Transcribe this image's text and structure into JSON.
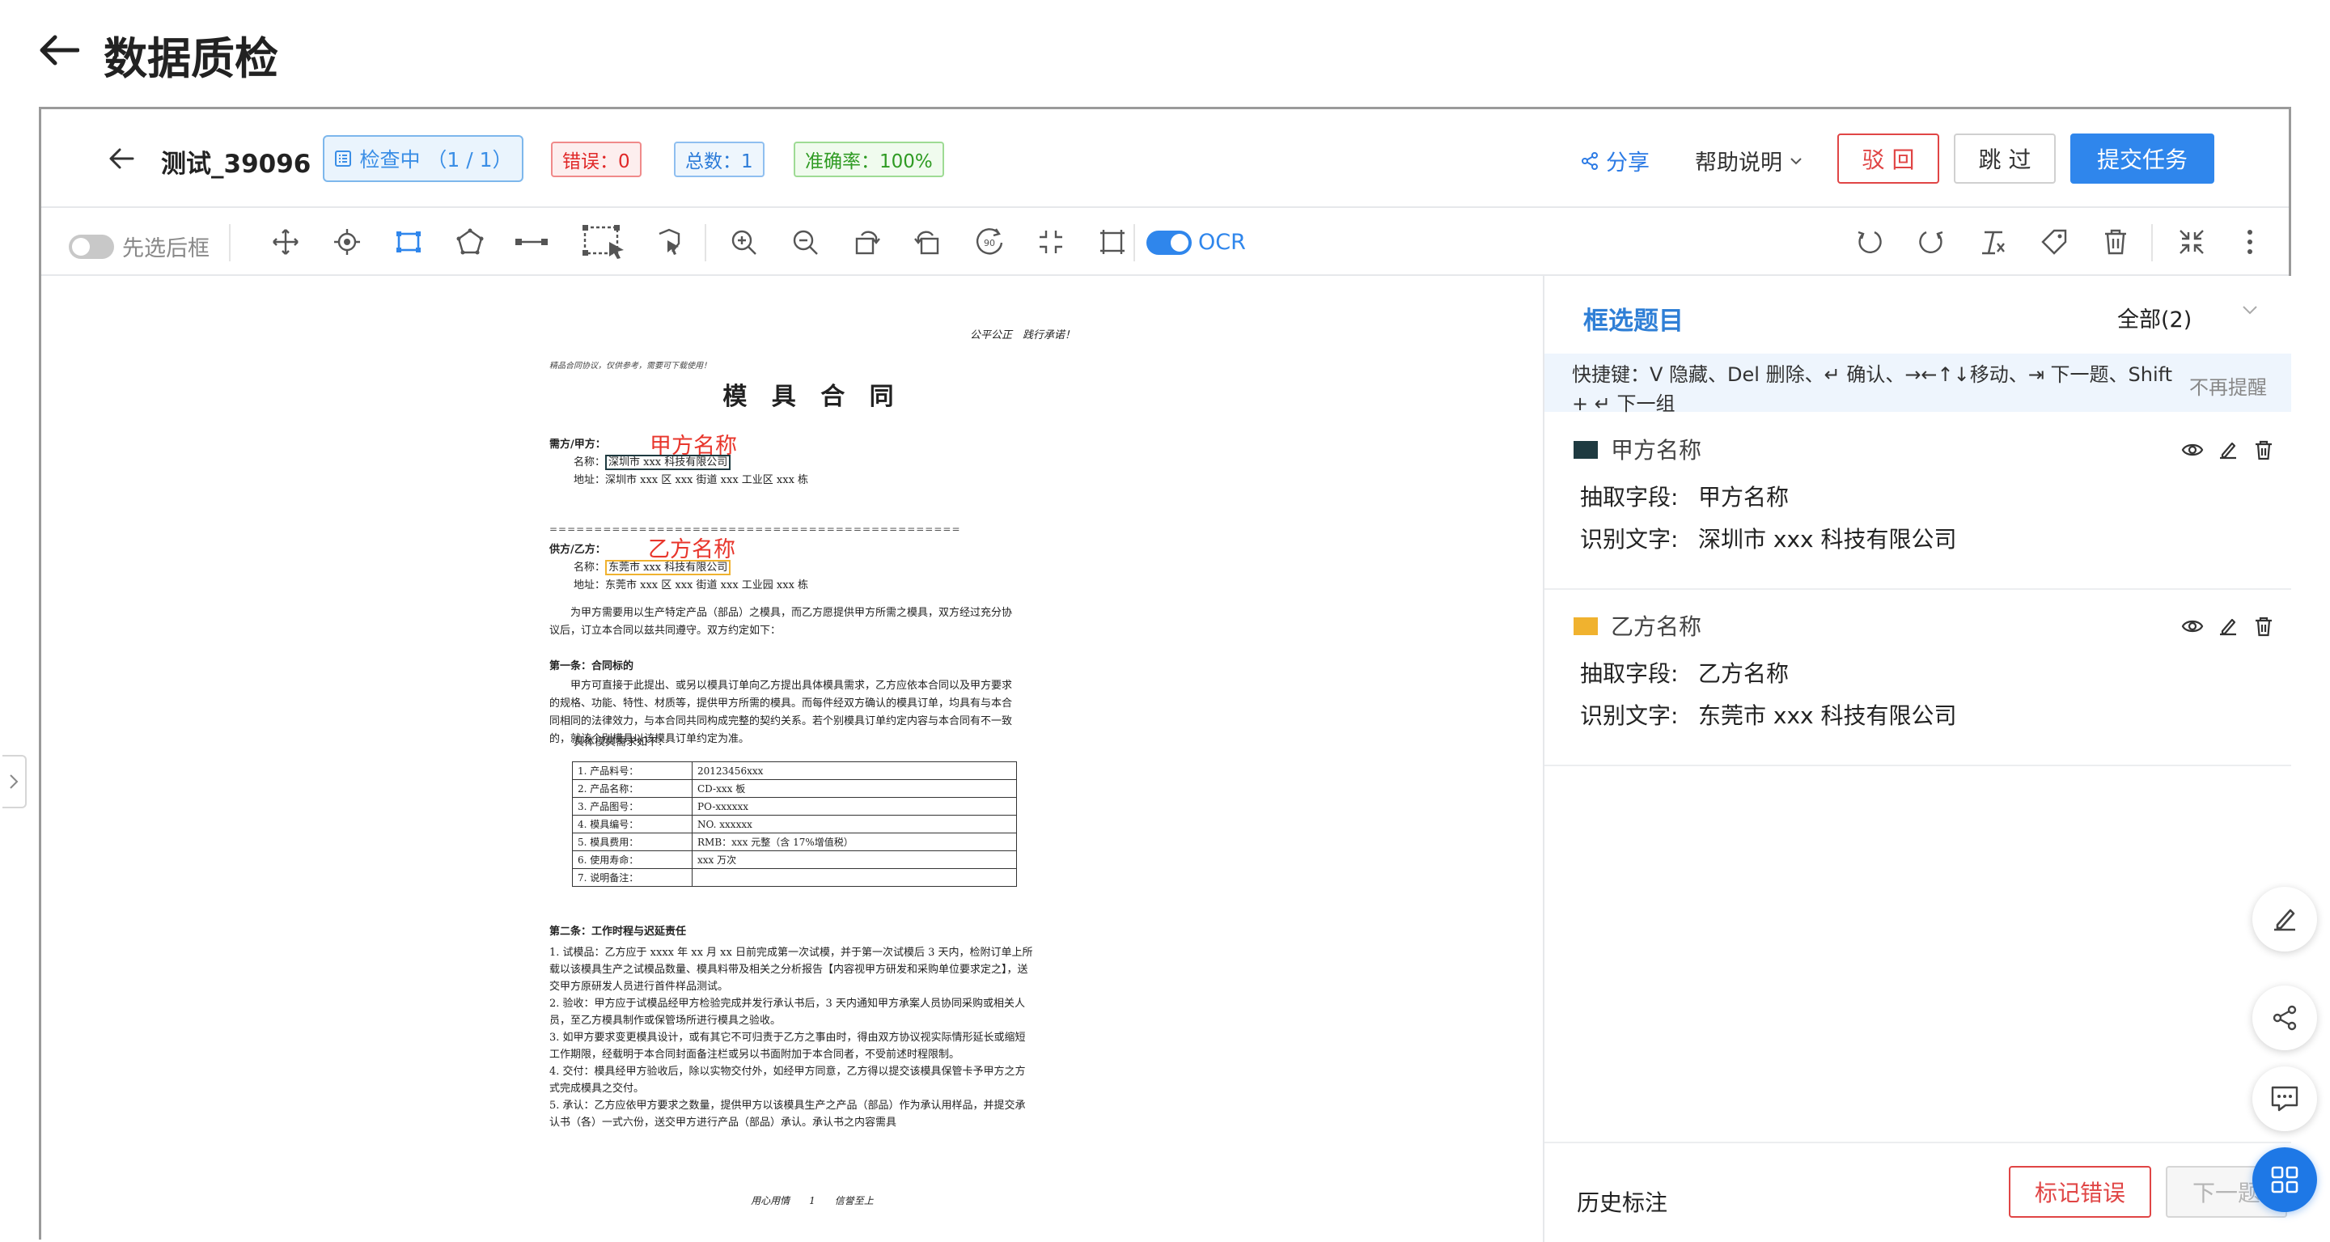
{
  "page": {
    "title": "数据质检"
  },
  "taskbar": {
    "task_name": "测试_39096",
    "status": "检查中 （1 / 1）",
    "error_tag": "错误：0",
    "total_tag": "总数：1",
    "accuracy_tag": "准确率：100%",
    "share": "分享",
    "help": "帮助说明",
    "reject": "驳 回",
    "skip": "跳 过",
    "submit": "提交任务"
  },
  "toolbar": {
    "box_first_label": "先选后框",
    "box_first_on": false,
    "ocr_label": "OCR",
    "ocr_on": true,
    "tools": [
      "move-icon",
      "point-icon",
      "rect-icon",
      "polygon-icon",
      "line-icon",
      "smart-select-icon",
      "cursor-select-icon",
      "zoom-in-icon",
      "zoom-out-icon",
      "rotate-left-icon",
      "rotate-right-icon",
      "rotate-90-icon",
      "fit-icon",
      "crop-icon"
    ],
    "right_tools": [
      "undo-icon",
      "redo-icon",
      "clear-icon",
      "tag-icon",
      "delete-icon",
      "fullscreen-icon",
      "more-icon"
    ]
  },
  "document": {
    "motto": "公平公正　践行承诺！",
    "note": "精品合同协议，仅供参考，需要可下载使用！",
    "title": "模 具 合 同",
    "party_a_heading": "需方/甲方：",
    "party_a_name_label": "名称：",
    "party_a_name": "深圳市 xxx 科技有限公司",
    "party_a_addr": "地址：深圳市 xxx 区 xxx 街道 xxx 工业区 xxx 栋",
    "party_b_heading": "供方/乙方：",
    "party_b_name_label": "名称：",
    "party_b_name": "东莞市 xxx 科技有限公司",
    "party_b_addr": "地址：东莞市 xxx 区 xxx 街道 xxx 工业园 xxx 栋",
    "ann_a": "甲方名称",
    "ann_b": "乙方名称",
    "separator": "==============================================",
    "intro": "为甲方需要用以生产特定产品（部品）之模具，而乙方愿提供甲方所需之模具，双方经过充分协议后，订立本合同以兹共同遵守。双方约定如下：",
    "art1_title": "第一条：合同标的",
    "art1_body": "甲方可直接于此提出、或另以模具订单向乙方提出具体模具需求，乙方应依本合同以及甲方要求的规格、功能、特性、材质等，提供甲方所需的模具。而每件经双方确认的模具订单，均具有与本合同相同的法律效力，与本合同共同构成完整的契约关系。若个别模具订单约定内容与本合同有不一致的，就该个别模具以该模具订单约定为准。",
    "req_label": "具体模具需求如下：",
    "table": [
      [
        "1. 产品料号：",
        "20123456xxx"
      ],
      [
        "2. 产品名称：",
        "CD-xxx 板"
      ],
      [
        "3. 产品图号：",
        "PO-xxxxxx"
      ],
      [
        "4. 模具编号：",
        "NO. xxxxxx"
      ],
      [
        "5. 模具费用：",
        "RMB：xxx 元整（含 17%增值税）"
      ],
      [
        "6. 使用寿命：",
        "xxx 万次"
      ],
      [
        "7. 说明备注：",
        ""
      ]
    ],
    "art2_title": "第二条：工作时程与迟延责任",
    "art2_items": [
      "1. 试模品：乙方应于 xxxx 年 xx 月 xx 日前完成第一次试模，并于第一次试模后 3 天内，检附订单上所载以该模具生产之试模品数量、模具料带及相关之分析报告【内容视甲方研发和采购单位要求定之】，送交甲方原研发人员进行首件样品测试。",
      "2. 验收：甲方应于试模品经甲方检验完成并发行承认书后，3 天内通知甲方承案人员协同采购或相关人员，至乙方模具制作或保管场所进行模具之验收。",
      "3. 如甲方要求变更模具设计，或有其它不可归责于乙方之事由时，得由双方协议视实际情形延长或缩短工作期限，经载明于本合同封面备注栏或另以书面附加于本合同者，不受前述时程限制。",
      "4. 交付：模具经甲方验收后，除以实物交付外，如经甲方同意，乙方得以提交该模具保管卡予甲方之方式完成模具之交付。",
      "5. 承认：乙方应依甲方要求之数量，提供甲方以该模具生产之产品（部品）作为承认用样品，并提交承认书（各）一式六份，送交甲方进行产品（部品）承认。承认书之内容需具"
    ],
    "footer": "用心用情　　1　　信誉至上"
  },
  "panel": {
    "title": "框选题目",
    "filter": "全部(2)",
    "hint": "快捷键：V 隐藏、Del 删除、↵ 确认、→←↑↓移动、⇥ 下一题、Shift + ↵ 下一组",
    "hint_close": "不再提醒",
    "field_label": "抽取字段:",
    "text_label": "识别文字:",
    "items": [
      {
        "name": "甲方名称",
        "field": "甲方名称",
        "text": "深圳市 xxx 科技有限公司",
        "color": "#1e3a40"
      },
      {
        "name": "乙方名称",
        "field": "乙方名称",
        "text": "东莞市 xxx 科技有限公司",
        "color": "#f0b22f"
      }
    ],
    "history": "历史标注",
    "mark_error": "标记错误",
    "next": "下一题"
  },
  "colors": {
    "accent": "#2f86ec",
    "danger": "#e04545",
    "annotation_red": "#e8352b"
  },
  "floating": [
    "edit-icon",
    "share-icon",
    "comment-icon",
    "apps-icon"
  ]
}
